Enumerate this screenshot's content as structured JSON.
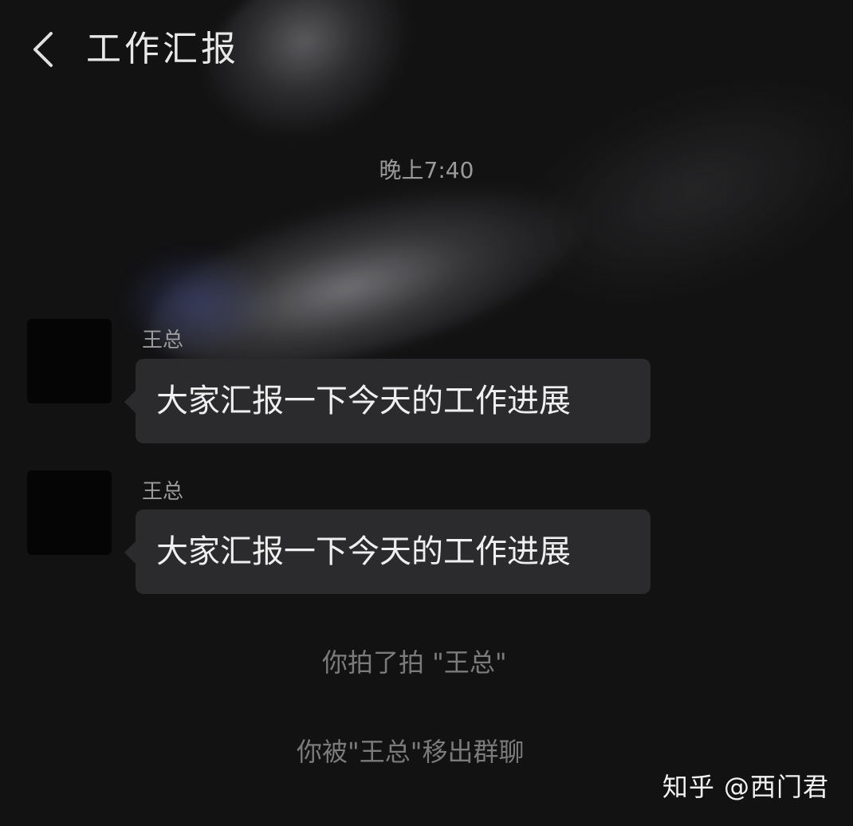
{
  "header": {
    "back_icon": "chevron-left-icon",
    "title": "工作汇报"
  },
  "chat": {
    "timestamp": "晚上7:40",
    "messages": [
      {
        "sender": "王总",
        "text": "大家汇报一下今天的工作进展"
      },
      {
        "sender": "王总",
        "text": "大家汇报一下今天的工作进展"
      }
    ],
    "system_messages": [
      "你拍了拍 \"王总\"",
      "你被\"王总\"移出群聊"
    ]
  },
  "watermark": "知乎 @西门君",
  "colors": {
    "background": "#121213",
    "bubble": "#2b2b2d",
    "text_primary": "#efefef",
    "text_secondary": "#9a9a9a"
  }
}
